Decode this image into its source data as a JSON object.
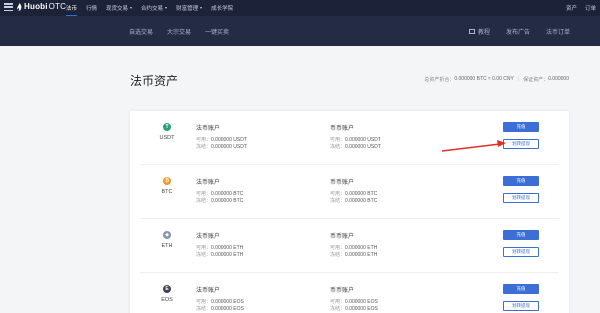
{
  "topbar": {
    "logo_main": "Huobi",
    "logo_sub": "OTC",
    "nav": [
      {
        "label": "法币",
        "active": true,
        "caret": false
      },
      {
        "label": "行情",
        "active": false,
        "caret": false
      },
      {
        "label": "现货交易",
        "active": false,
        "caret": true
      },
      {
        "label": "合约交易",
        "active": false,
        "caret": true
      },
      {
        "label": "财富管理",
        "active": false,
        "caret": true
      },
      {
        "label": "成长学院",
        "active": false,
        "caret": false
      }
    ],
    "right": [
      "资产",
      "订单"
    ]
  },
  "subbar": {
    "nav": [
      "自选交易",
      "大宗交易",
      "一键买卖"
    ],
    "right": [
      {
        "label": "教程",
        "icon": "tutorial-icon"
      },
      {
        "label": "发布广告",
        "icon": "publish-ad-icon"
      },
      {
        "label": "法币订单",
        "icon": "orders-icon"
      }
    ]
  },
  "page": {
    "title": "法币资产",
    "total_label": "总资产折合：",
    "total_value": "0.000000 BTC ≈ 0.00 CNY",
    "margin_label": "保证资产：",
    "margin_value": "0.000000"
  },
  "labels": {
    "legal_account": "法币账户",
    "coin_account": "币币账户",
    "available": "可用：",
    "frozen": "冻结：",
    "recharge": "充值",
    "transfer": "划转提现"
  },
  "assets": [
    {
      "coin": "USDT",
      "color": "#26a17b",
      "glyph": "T",
      "legal_available": "0.000000 USDT",
      "legal_frozen": "0.000000 USDT",
      "coin_available": "0.000000 USDT",
      "coin_frozen": "0.000000 USDT"
    },
    {
      "coin": "BTC",
      "color": "#f7931a",
      "glyph": "₿",
      "legal_available": "0.000000 BTC",
      "legal_frozen": "0.000000 BTC",
      "coin_available": "0.000000 BTC",
      "coin_frozen": "0.000000 BTC"
    },
    {
      "coin": "ETH",
      "color": "#8a92b2",
      "glyph": "◆",
      "legal_available": "0.000000 ETH",
      "legal_frozen": "0.000000 ETH",
      "coin_available": "0.000000 ETH",
      "coin_frozen": "0.000000 ETH"
    },
    {
      "coin": "EOS",
      "color": "#443f54",
      "glyph": "E",
      "legal_available": "0.000000 EOS",
      "legal_frozen": "0.000000 EOS",
      "coin_available": "0.000000 EOS",
      "coin_frozen": "0.000000 EOS"
    }
  ],
  "colors": {
    "topbar": "#1c2237",
    "subbar": "#232b45",
    "accent": "#3b6fd6",
    "annotation_arrow": "#e0312a"
  }
}
